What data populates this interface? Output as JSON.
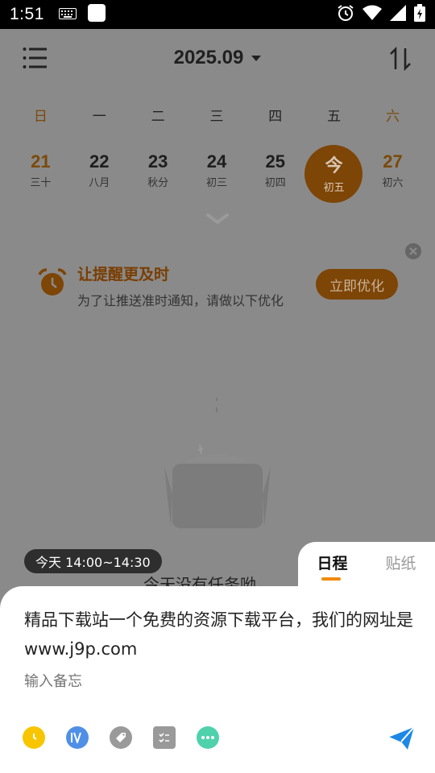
{
  "status_bar": {
    "time": "1:51"
  },
  "header": {
    "month": "2025.09"
  },
  "weekdays": [
    "日",
    "一",
    "二",
    "三",
    "四",
    "五",
    "六"
  ],
  "dates": [
    {
      "day": "21",
      "lunar": "三十"
    },
    {
      "day": "22",
      "lunar": "八月"
    },
    {
      "day": "23",
      "lunar": "秋分"
    },
    {
      "day": "24",
      "lunar": "初三"
    },
    {
      "day": "25",
      "lunar": "初四"
    },
    {
      "day": "今",
      "lunar": "初五"
    },
    {
      "day": "27",
      "lunar": "初六"
    }
  ],
  "reminder": {
    "title": "让提醒更及时",
    "subtitle": "为了让推送准时通知，请做以下优化",
    "button": "立即优化"
  },
  "empty_state": {
    "text": "今天没有任务呦"
  },
  "sheet": {
    "time_chip": "今天 14:00~14:30",
    "tabs": [
      "日程",
      "贴纸"
    ],
    "content": "精品下载站一个免费的资源下载平台，我们的网址是www.j9p.com",
    "memo_placeholder": "输入备忘"
  },
  "colors": {
    "accent": "#f08a0a",
    "today_circle": "#7d4506",
    "send": "#1e88e5"
  }
}
